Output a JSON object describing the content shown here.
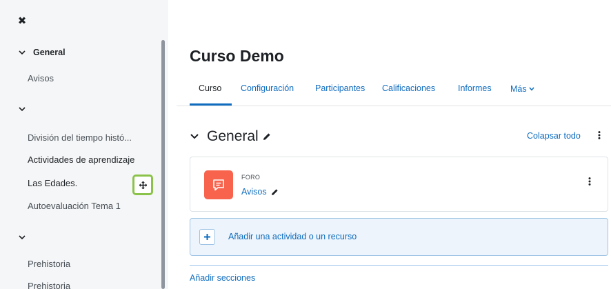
{
  "drawer": {
    "close_icon": "close-icon",
    "sections": [
      {
        "title": "General",
        "items": [
          "Avisos"
        ]
      },
      {
        "title": "",
        "items": [
          "División del tiempo histó...",
          "Actividades de aprendizaje",
          "Las Edades.",
          "Autoevaluación Tema 1"
        ]
      },
      {
        "title": "",
        "items": [
          "Prehistoria",
          "Prehistoria"
        ]
      }
    ]
  },
  "page": {
    "title": "Curso Demo",
    "tabs": [
      "Curso",
      "Configuración",
      "Participantes",
      "Calificaciones",
      "Informes",
      "Más"
    ],
    "active_tab": "Curso"
  },
  "section": {
    "name": "General",
    "collapse_all": "Colapsar todo"
  },
  "activity": {
    "type": "FORO",
    "name": "Avisos",
    "icon": "forum-icon",
    "icon_color": "#f7634d"
  },
  "add_activity_label": "Añadir una actividad o un recurso",
  "add_sections_label": "Añadir secciones",
  "colors": {
    "link": "#0f6cbf",
    "highlight": "#8bc34a",
    "drawer_bg": "#f5f6f7"
  }
}
